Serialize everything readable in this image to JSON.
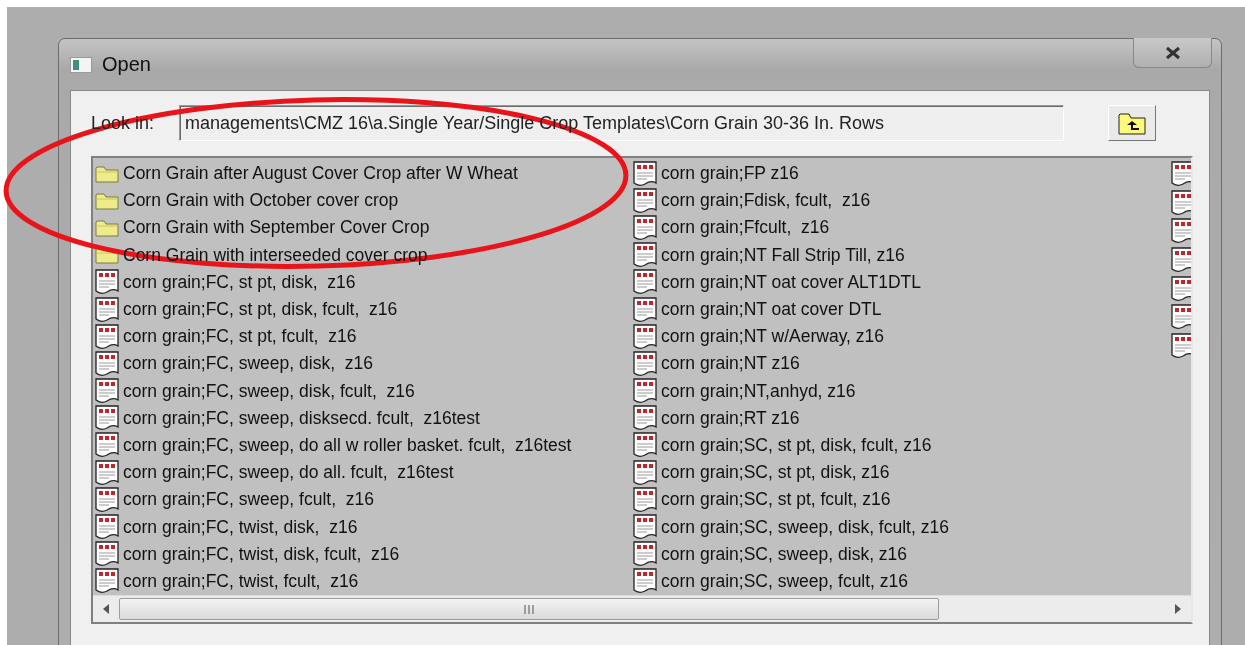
{
  "window": {
    "title": "Open"
  },
  "look_in": {
    "label": "Look in:",
    "value": "managements\\CMZ 16\\a.Single Year/Single Crop Templates\\Corn Grain 30-36 In. Rows"
  },
  "columns": [
    {
      "items": [
        {
          "kind": "folder",
          "label": "Corn Grain after August Cover Crop after W Wheat"
        },
        {
          "kind": "folder",
          "label": "Corn Grain with October cover crop"
        },
        {
          "kind": "folder",
          "label": "Corn Grain with September Cover Crop"
        },
        {
          "kind": "folder",
          "label": "Corn Grain with interseeded cover crop"
        },
        {
          "kind": "file",
          "label": "corn grain;FC, st pt, disk,  z16"
        },
        {
          "kind": "file",
          "label": "corn grain;FC, st pt, disk, fcult,  z16"
        },
        {
          "kind": "file",
          "label": "corn grain;FC, st pt, fcult,  z16"
        },
        {
          "kind": "file",
          "label": "corn grain;FC, sweep, disk,  z16"
        },
        {
          "kind": "file",
          "label": "corn grain;FC, sweep, disk, fcult,  z16"
        },
        {
          "kind": "file",
          "label": "corn grain;FC, sweep, disksecd. fcult,  z16test"
        },
        {
          "kind": "file",
          "label": "corn grain;FC, sweep, do all w roller basket. fcult,  z16test"
        },
        {
          "kind": "file",
          "label": "corn grain;FC, sweep, do all. fcult,  z16test"
        },
        {
          "kind": "file",
          "label": "corn grain;FC, sweep, fcult,  z16"
        },
        {
          "kind": "file",
          "label": "corn grain;FC, twist, disk,  z16"
        },
        {
          "kind": "file",
          "label": "corn grain;FC, twist, disk, fcult,  z16"
        },
        {
          "kind": "file",
          "label": "corn grain;FC, twist, fcult,  z16"
        }
      ]
    },
    {
      "items": [
        {
          "kind": "file",
          "label": "corn grain;FP z16"
        },
        {
          "kind": "file",
          "label": "corn grain;Fdisk, fcult,  z16"
        },
        {
          "kind": "file",
          "label": "corn grain;Ffcult,  z16"
        },
        {
          "kind": "file",
          "label": "corn grain;NT Fall Strip Till, z16"
        },
        {
          "kind": "file",
          "label": "corn grain;NT oat cover ALT1DTL"
        },
        {
          "kind": "file",
          "label": "corn grain;NT oat cover DTL"
        },
        {
          "kind": "file",
          "label": "corn grain;NT w/Aerway, z16"
        },
        {
          "kind": "file",
          "label": "corn grain;NT z16"
        },
        {
          "kind": "file",
          "label": "corn grain;NT,anhyd, z16"
        },
        {
          "kind": "file",
          "label": "corn grain;RT z16"
        },
        {
          "kind": "file",
          "label": "corn grain;SC, st pt, disk, fcult, z16"
        },
        {
          "kind": "file",
          "label": "corn grain;SC, st pt, disk, z16"
        },
        {
          "kind": "file",
          "label": "corn grain;SC, st pt, fcult, z16"
        },
        {
          "kind": "file",
          "label": "corn grain;SC, sweep, disk, fcult, z16"
        },
        {
          "kind": "file",
          "label": "corn grain;SC, sweep, disk, z16"
        },
        {
          "kind": "file",
          "label": "corn grain;SC, sweep, fcult, z16"
        }
      ]
    },
    {
      "items": [
        {
          "kind": "file"
        },
        {
          "kind": "file"
        },
        {
          "kind": "file"
        },
        {
          "kind": "file"
        },
        {
          "kind": "file"
        },
        {
          "kind": "file"
        },
        {
          "kind": "file"
        }
      ]
    }
  ],
  "annotation": {
    "kind": "ellipse"
  }
}
